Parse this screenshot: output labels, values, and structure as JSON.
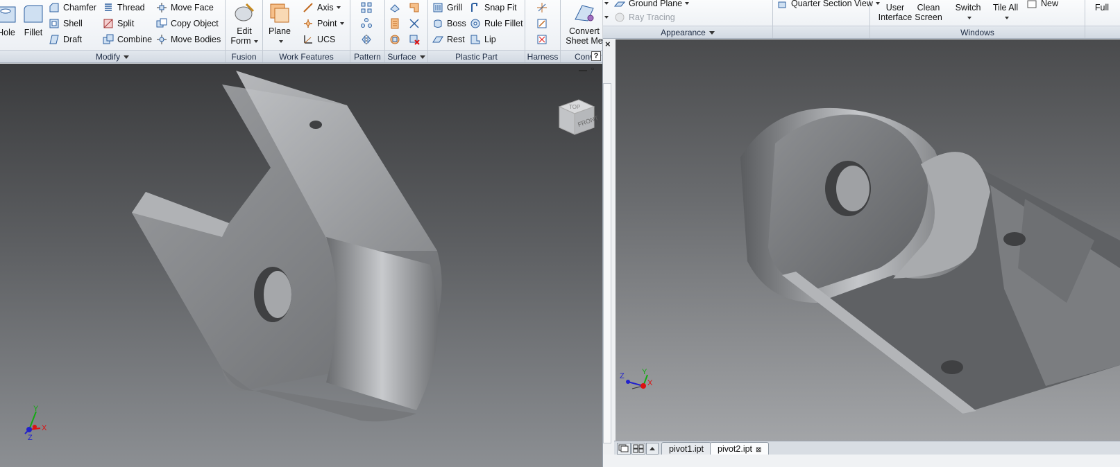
{
  "left_ribbon": {
    "modify": {
      "label": "Modify",
      "buttons": [
        "Hole",
        "Fillet",
        "Chamfer",
        "Thread",
        "Move Face",
        "Shell",
        "Split",
        "Copy Object",
        "Draft",
        "Combine",
        "Move Bodies"
      ]
    },
    "fusion": {
      "label": "Fusion",
      "edit_form": "Edit\nForm"
    },
    "work_features": {
      "label": "Work Features",
      "plane": "Plane",
      "axis": "Axis",
      "point": "Point",
      "ucs": "UCS"
    },
    "pattern": {
      "label": "Pattern"
    },
    "surface": {
      "label": "Surface"
    },
    "plastic_part": {
      "label": "Plastic Part",
      "buttons": [
        "Grill",
        "Snap Fit",
        "Boss",
        "Rule Fillet",
        "Rest",
        "Lip"
      ]
    },
    "harness": {
      "label": "Harness"
    },
    "convert": {
      "label": "Conver",
      "button": "Convert\nSheet Me"
    }
  },
  "right_ribbon": {
    "ground_plane": "Ground Plane",
    "ray_tracing": "Ray Tracing",
    "quarter_section": "Quarter Section View",
    "appearance_label": "Appearance",
    "user_interface": "User\nInterface",
    "clean_screen": "Clean\nScreen",
    "switch": "Switch",
    "tile_all": "Tile All",
    "new": "New",
    "full": "Full",
    "windows_label": "Windows"
  },
  "viewcube": {
    "front_label": "FRONT",
    "top_label": "TOP"
  },
  "axis_labels": {
    "x": "X",
    "y": "Y",
    "z": "Z"
  },
  "help_icon": "?",
  "doc_tabs": [
    "pivot1.ipt",
    "pivot2.ipt"
  ],
  "colors": {
    "ribbon_bg": "#eef1f5",
    "group_label": "#d6dce4",
    "axis_x": "#d11",
    "axis_y": "#1a1",
    "axis_z": "#22c"
  }
}
